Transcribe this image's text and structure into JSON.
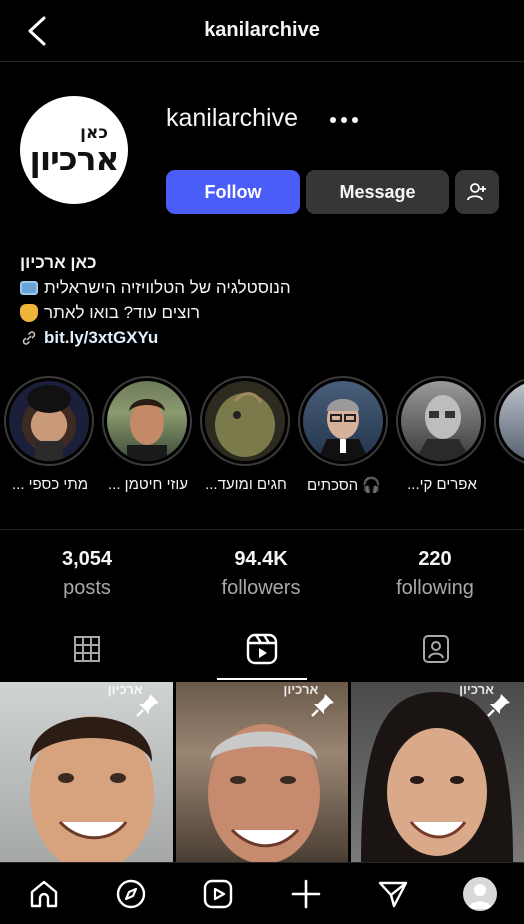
{
  "header": {
    "title": "kanilarchive",
    "back_icon": "chevron-left-icon"
  },
  "profile": {
    "username": "kanilarchive",
    "avatar_text_top": "כאן",
    "avatar_text_bottom": "ארכיון",
    "follow_label": "Follow",
    "message_label": "Message",
    "more_icon": "more-horizontal-icon",
    "add_user_icon": "add-user-icon"
  },
  "bio": {
    "name": "כאן ארכיון",
    "line1": "הנוסטלגיה של הטלוויזיה הישראלית",
    "line2": "רוצים עוד? בואו לאתר",
    "link": "bit.ly/3xtGXYu"
  },
  "highlights": [
    {
      "label": "מתי כספי ..."
    },
    {
      "label": "עוזי חיטמן ..."
    },
    {
      "label": "חגים ומועד..."
    },
    {
      "label": "🎧 הסכתים"
    },
    {
      "label": "אפרים קי..."
    }
  ],
  "stats": [
    {
      "value": "3,054",
      "label": "posts"
    },
    {
      "value": "94.4K",
      "label": "followers"
    },
    {
      "value": "220",
      "label": "following"
    }
  ],
  "tabs": [
    {
      "icon": "grid-icon",
      "active": false
    },
    {
      "icon": "reels-icon",
      "active": true
    },
    {
      "icon": "tagged-icon",
      "active": false
    }
  ],
  "posts_watermark": "ארכיון",
  "nav": [
    "home-icon",
    "explore-icon",
    "reels-icon",
    "create-icon",
    "direct-icon",
    "profile-avatar"
  ],
  "colors": {
    "follow": "#4a5df9",
    "secondary_button": "#363636",
    "background": "#000000"
  }
}
